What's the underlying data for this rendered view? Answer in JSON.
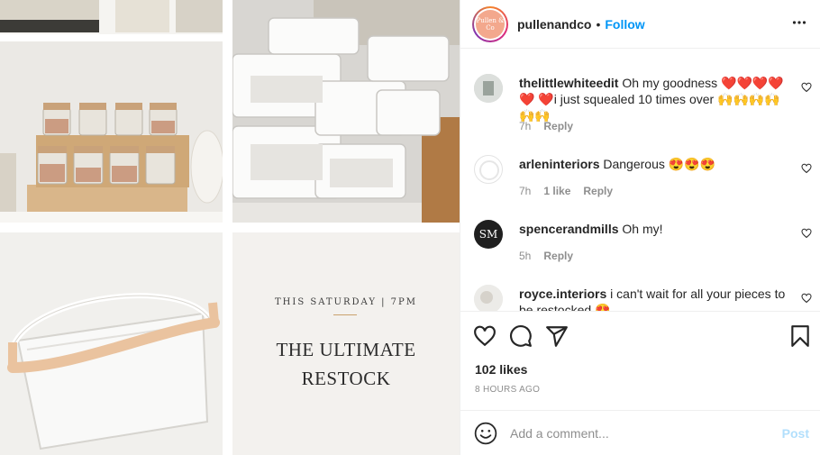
{
  "post": {
    "username": "pullenandco",
    "separator": "•",
    "follow_label": "Follow",
    "logo_text": "Pullen & Co",
    "promo": {
      "subtitle": "THIS SATURDAY | 7PM",
      "title_line1": "THE ULTIMATE",
      "title_line2": "RESTOCK"
    }
  },
  "comments": [
    {
      "user": "thelittlewhiteedit",
      "text": "Oh my goodness ❤️❤️❤️❤️❤️ ❤️i just squealed 10 times over 🙌🙌🙌🙌🙌🙌",
      "time": "7h",
      "likes": "",
      "reply": "Reply"
    },
    {
      "user": "arleninteriors",
      "text": "Dangerous 😍😍😍",
      "time": "7h",
      "likes": "1 like",
      "reply": "Reply"
    },
    {
      "user": "spencerandmills",
      "text": "Oh my!",
      "time": "5h",
      "likes": "",
      "reply": "Reply"
    },
    {
      "user": "royce.interiors",
      "text": "i can't wait for all your pieces to be restocked 😍",
      "time": "",
      "likes": "",
      "reply": ""
    }
  ],
  "avatars": {
    "spencer_initials": "SM"
  },
  "stats": {
    "likes": "102 likes",
    "time_ago": "8 HOURS AGO"
  },
  "add_comment": {
    "placeholder": "Add a comment...",
    "post_label": "Post"
  },
  "colors": {
    "follow": "#0095f6",
    "post_disabled": "#b2dffc",
    "muted": "#8e8e8e",
    "text": "#262626"
  }
}
